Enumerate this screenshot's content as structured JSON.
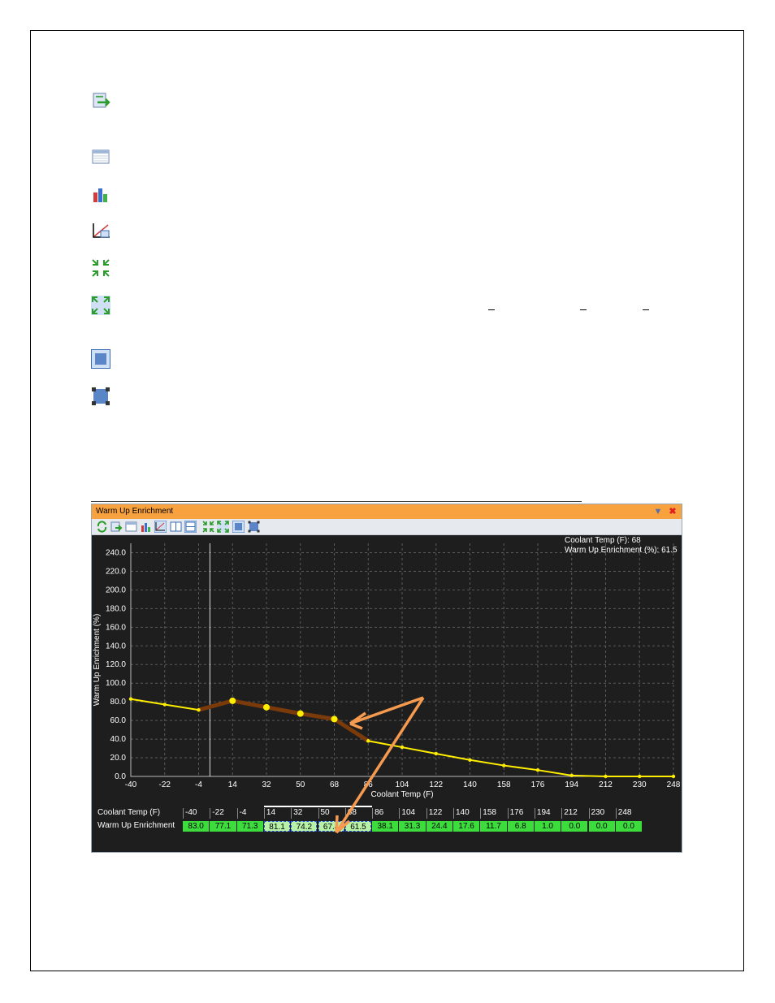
{
  "sidebar_icons": [
    {
      "name": "swap-icon"
    },
    {
      "name": "table-view-icon"
    },
    {
      "name": "bar-chart-icon"
    },
    {
      "name": "chart-table-icon"
    },
    {
      "name": "collapse-icon"
    },
    {
      "name": "expand-icon"
    },
    {
      "name": "select-box-icon"
    },
    {
      "name": "square-select-icon"
    }
  ],
  "window": {
    "title": "Warm Up Enrichment",
    "minimize_icon": "pin-icon",
    "close_icon": "close-icon",
    "colors": {
      "title_bg": "#f7a23e",
      "chart_bg": "#1e1e1e",
      "line": "#ffee00",
      "highlight": "#7a3a0a",
      "cell_green": "#3ddc3d",
      "arrow": "#f59a4e"
    }
  },
  "cursor_readout": {
    "line1": "Coolant Temp (F): 68",
    "line2": "Warm Up Enrichment (%): 61.5"
  },
  "chart_data": {
    "type": "line",
    "xlabel": "Coolant Temp (F)",
    "ylabel": "Warm Up Enrichment (%)",
    "x": [
      -40,
      -22,
      -4,
      14,
      32,
      50,
      68,
      86,
      104,
      122,
      140,
      158,
      176,
      194,
      212,
      230,
      248
    ],
    "x_tick_labels": [
      "-40",
      "-22",
      "-4",
      "14",
      "32",
      "50",
      "68",
      "86",
      "104",
      "122",
      "140",
      "158",
      "176",
      "194",
      "212",
      "230",
      "248"
    ],
    "y_tick_labels": [
      "0.0",
      "20.0",
      "40.0",
      "60.0",
      "80.0",
      "100.0",
      "120.0",
      "140.0",
      "160.0",
      "180.0",
      "200.0",
      "220.0",
      "240.0"
    ],
    "series": [
      {
        "values": [
          83.0,
          77.1,
          71.3,
          81.1,
          74.2,
          67.4,
          61.5,
          38.1,
          31.3,
          24.4,
          17.6,
          11.7,
          6.8,
          1.0,
          0.0,
          0.0,
          0.0
        ]
      }
    ],
    "selected_range": [
      14,
      86
    ],
    "ylim": [
      0,
      250
    ],
    "xlim": [
      -40,
      248
    ],
    "grid": true
  },
  "table": {
    "row1_label": "Coolant Temp (F)",
    "row2_label": "Warm Up Enrichment",
    "headers": [
      "-40",
      "-22",
      "-4",
      "14",
      "32",
      "50",
      "68",
      "86",
      "104",
      "122",
      "140",
      "158",
      "176",
      "194",
      "212",
      "230",
      "248"
    ],
    "values": [
      "83.0",
      "77.1",
      "71.3",
      "81.1",
      "74.2",
      "67.4",
      "61.5",
      "38.1",
      "31.3",
      "24.4",
      "17.6",
      "11.7",
      "6.8",
      "1.0",
      "0.0",
      "0.0",
      "0.0"
    ]
  }
}
